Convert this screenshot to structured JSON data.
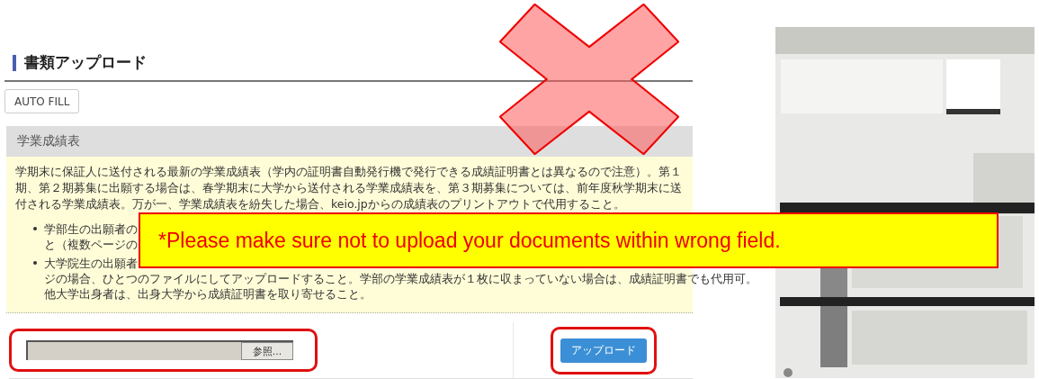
{
  "page_title": "書類アップロード",
  "auto_fill_button": "AUTO FILL",
  "section": {
    "title": "学業成績表",
    "paragraph": "学期末に保証人に送付される最新の学業成績表（学内の証明書自動発行機で発行できる成績証明書とは異なるので注意）。第１期、第２期募集に出願する場合は、春学期末に大学から送付される学業成績表を、第３期募集については、前年度秋学期末に送付される学業成績表。万が一、学業成績表を紛失した場合、keio.jpからの成績表のプリントアウトで代用すること。",
    "bullets": [
      {
        "lines": [
          "学部生の出願者の",
          "と（複数ページの"
        ]
      },
      {
        "lines": [
          "大学院生の出願者",
          "ジの場合、ひとつのファイルにしてアップロードすること。学部の学業成績表が１枚に収まっていない場合は、成績証明書でも代用可。",
          "他大学出身者は、出身大学から成績証明書を取り寄せること。"
        ]
      }
    ]
  },
  "file_input": {
    "browse_button": "参照..."
  },
  "upload_button": "アップロード",
  "warning_banner": "*Please make sure not to upload your documents within wrong field."
}
